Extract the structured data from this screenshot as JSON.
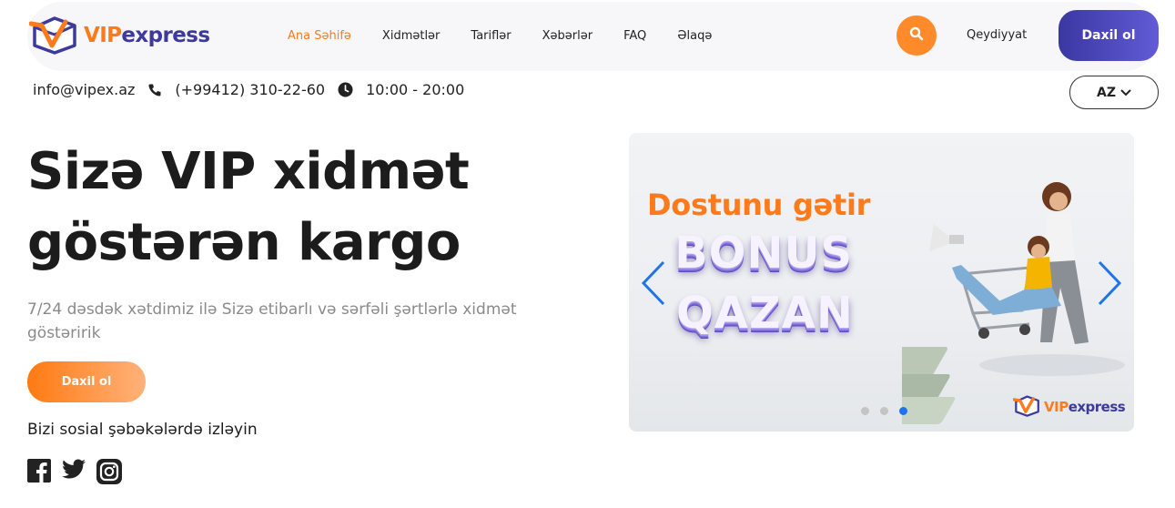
{
  "brand": {
    "name_vip": "VIP",
    "name_rest": "express",
    "primary": "#3e3a9c",
    "accent": "#ff7a1a"
  },
  "nav": {
    "items": [
      {
        "label": "Ana Səhifə",
        "active": true
      },
      {
        "label": "Xidmətlər",
        "active": false
      },
      {
        "label": "Tariflər",
        "active": false
      },
      {
        "label": "Xəbərlər",
        "active": false
      },
      {
        "label": "FAQ",
        "active": false
      },
      {
        "label": "Əlaqə",
        "active": false
      }
    ],
    "search_icon": "search-icon",
    "register_label": "Qeydiyyat",
    "login_label": "Daxil ol"
  },
  "contact": {
    "email": "info@vipex.az",
    "phone": "(+99412) 310-22-60",
    "hours": "10:00 - 20:00",
    "phone_icon": "phone-icon",
    "clock_icon": "clock-icon"
  },
  "language": {
    "selected": "AZ"
  },
  "hero": {
    "title_line1": "Sizə VIP xidmət",
    "title_line2": "göstərən kargo",
    "subtitle": "7/24 dəsdək xətdimiz ilə Sizə etibarlı və sərfəli şərtlərlə xidmət göstəririk",
    "cta_label": "Daxil ol",
    "social_label": "Bizi sosial şəbəkələrdə izləyin",
    "social_icons": [
      "facebook-icon",
      "twitter-icon",
      "instagram-icon"
    ]
  },
  "banner": {
    "headline": "Dostunu gətir",
    "bonus": "BONUS",
    "qazan": "QAZAN",
    "logo_vip": "VIP",
    "logo_rest": "express",
    "slide_count": 3,
    "active_slide": 3
  }
}
